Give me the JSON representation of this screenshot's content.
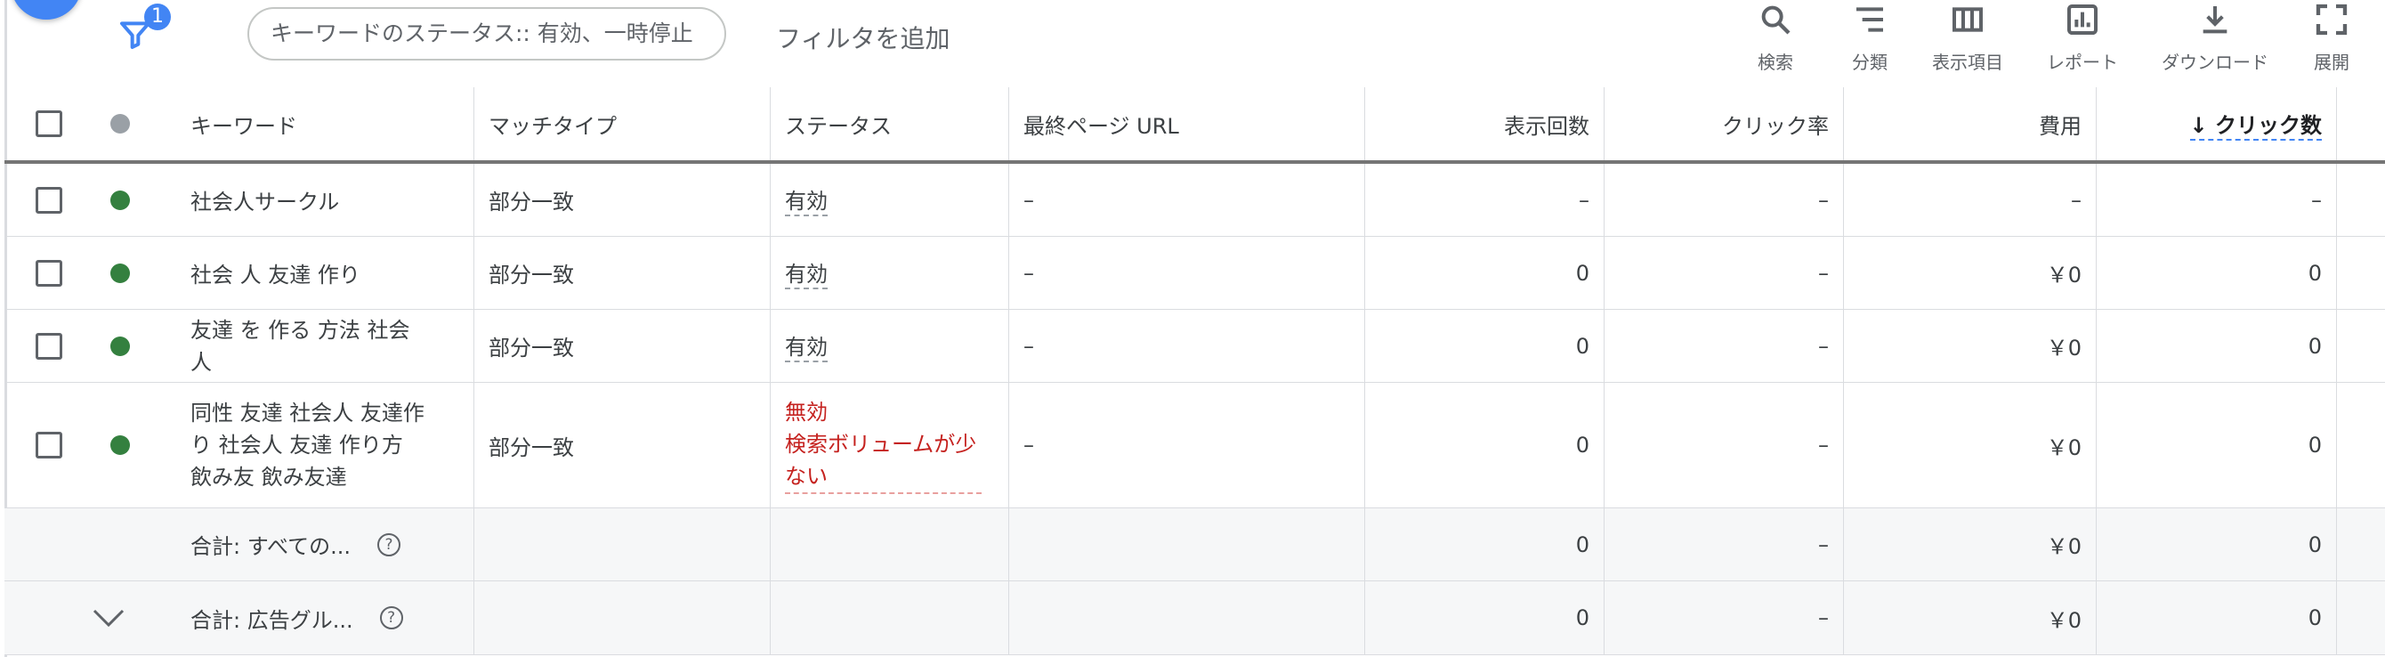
{
  "toolbar": {
    "filter_badge": "1",
    "filter_chip": "キーワードのステータス:: 有効、一時停止",
    "add_filter": "フィルタを追加",
    "tools": [
      {
        "label": "検索",
        "icon": "search-icon"
      },
      {
        "label": "分類",
        "icon": "segment-icon"
      },
      {
        "label": "表示項目",
        "icon": "columns-icon"
      },
      {
        "label": "レポート",
        "icon": "report-icon"
      },
      {
        "label": "ダウンロード",
        "icon": "download-icon"
      },
      {
        "label": "展開",
        "icon": "expand-icon"
      }
    ]
  },
  "table": {
    "headers": {
      "keyword": "キーワード",
      "match_type": "マッチタイプ",
      "status": "ステータス",
      "final_url": "最終ページ URL",
      "impressions": "表示回数",
      "ctr": "クリック率",
      "cost": "費用",
      "clicks": "↓ クリック数"
    },
    "rows": [
      {
        "keyword": "社会人サークル",
        "match_type": "部分一致",
        "status": "有効",
        "status_detail": "",
        "final_url": "–",
        "impressions": "–",
        "ctr": "–",
        "cost": "–",
        "clicks": "–"
      },
      {
        "keyword": "社会 人 友達 作り",
        "match_type": "部分一致",
        "status": "有効",
        "status_detail": "",
        "final_url": "–",
        "impressions": "0",
        "ctr": "–",
        "cost": "￥0",
        "clicks": "0"
      },
      {
        "keyword": "友達 を 作る 方法 社会 人",
        "match_type": "部分一致",
        "status": "有効",
        "status_detail": "",
        "final_url": "–",
        "impressions": "0",
        "ctr": "–",
        "cost": "￥0",
        "clicks": "0"
      },
      {
        "keyword": "同性 友達 社会人 友達作り 社会人 友達 作り方 飲み友 飲み友達",
        "match_type": "部分一致",
        "status": "無効",
        "status_detail": "検索ボリュームが少ない",
        "final_url": "–",
        "impressions": "0",
        "ctr": "–",
        "cost": "￥0",
        "clicks": "0"
      }
    ],
    "totals": [
      {
        "label": "合計: すべての...",
        "impressions": "0",
        "ctr": "–",
        "cost": "￥0",
        "clicks": "0"
      },
      {
        "label": "合計: 広告グル...",
        "impressions": "0",
        "ctr": "–",
        "cost": "￥0",
        "clicks": "0"
      }
    ]
  },
  "colors": {
    "accent": "#4285f4",
    "status_ok": "#34803f",
    "status_bad": "#c5221f"
  }
}
